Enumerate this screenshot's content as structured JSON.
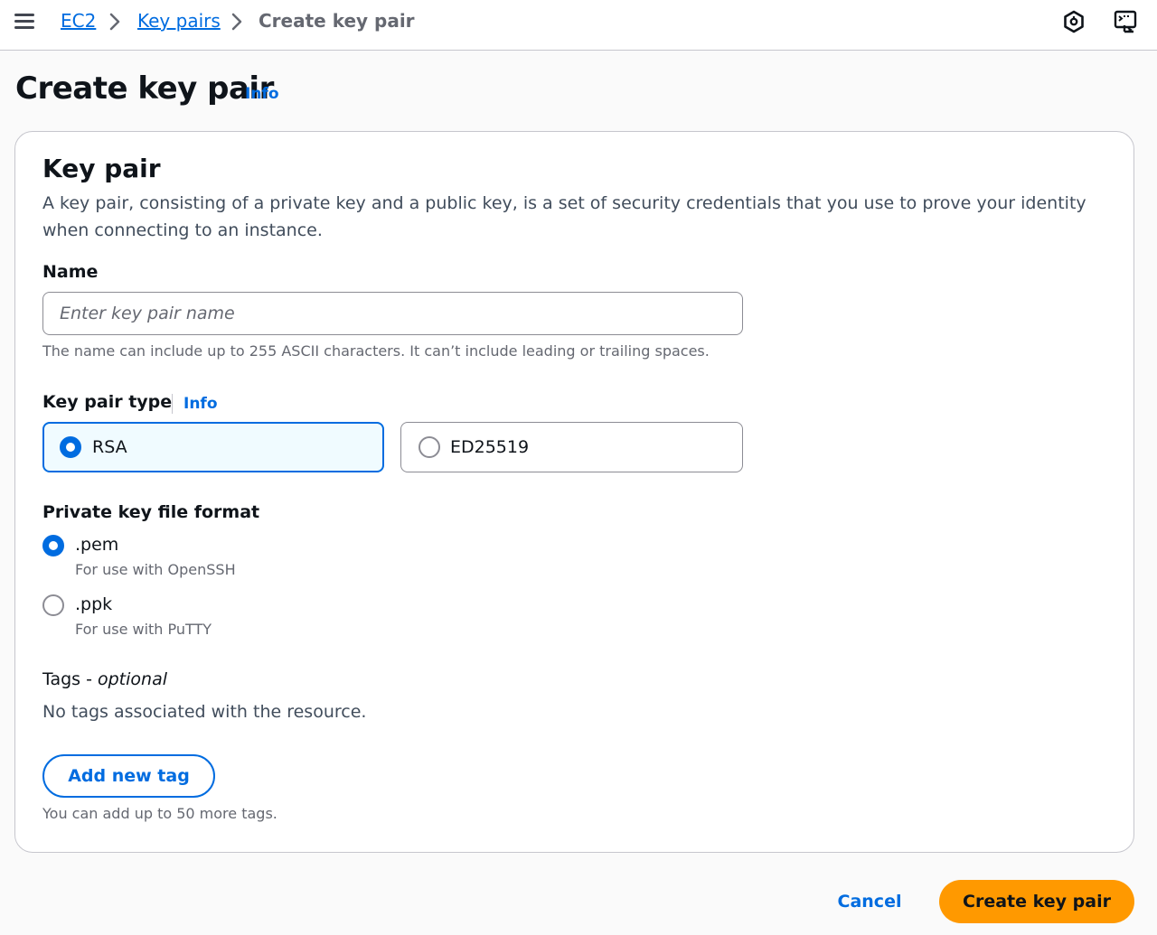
{
  "breadcrumb": {
    "items": [
      {
        "label": "EC2"
      },
      {
        "label": "Key pairs"
      }
    ],
    "current": "Create key pair"
  },
  "icons": {
    "menu": "hamburger-menu-icon",
    "chevron": "chevron-right-icon",
    "notifications": "hexagon-icon",
    "cloudshell": "terminal-icon"
  },
  "page": {
    "title": "Create key pair",
    "info_label": "Info"
  },
  "key_pair_section": {
    "title": "Key pair",
    "description": "A key pair, consisting of a private key and a public key, is a set of security credentials that you use to prove your identity when connecting to an instance."
  },
  "name_field": {
    "label": "Name",
    "value": "",
    "placeholder": "Enter key pair name",
    "hint": "The name can include up to 255 ASCII characters. It can’t include leading or trailing spaces."
  },
  "key_pair_type": {
    "label": "Key pair type",
    "info_label": "Info",
    "options": [
      {
        "label": "RSA",
        "selected": true
      },
      {
        "label": "ED25519",
        "selected": false
      }
    ]
  },
  "file_format": {
    "label": "Private key file format",
    "options": [
      {
        "label": ".pem",
        "description": "For use with OpenSSH",
        "selected": true
      },
      {
        "label": ".ppk",
        "description": "For use with PuTTY",
        "selected": false
      }
    ]
  },
  "tags": {
    "label": "Tags - ",
    "label_optional": "optional",
    "empty_message": "No tags associated with the resource.",
    "add_button": "Add new tag",
    "limit_hint": "You can add up to 50 more tags."
  },
  "actions": {
    "cancel": "Cancel",
    "submit": "Create key pair"
  },
  "colors": {
    "link": "#006ce0",
    "primary_button": "#ff9900",
    "selected_tile_bg": "#f0fbff"
  }
}
